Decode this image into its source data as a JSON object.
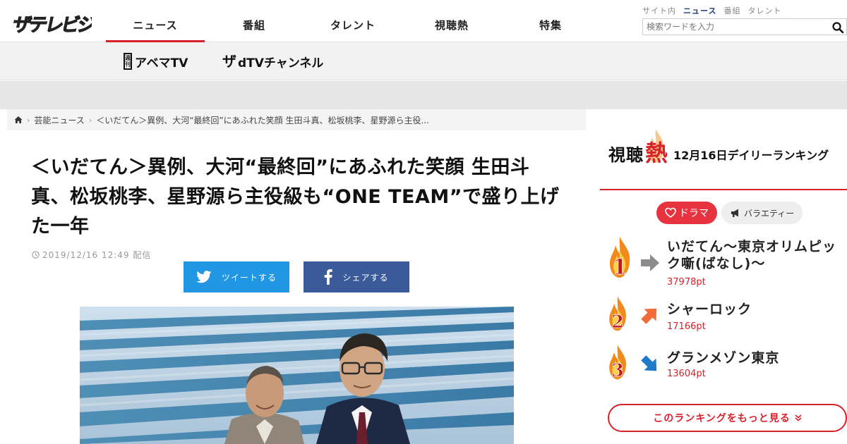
{
  "header": {
    "logo_text": "ザテレビジョン",
    "nav": [
      "ニュース",
      "番組",
      "タレント",
      "視聴熱",
      "特集"
    ],
    "active_nav": 0,
    "search": {
      "scopes": [
        "サイト内",
        "ニュース",
        "番組",
        "タレント"
      ],
      "active_scope": 1,
      "placeholder": "検索ワードを入力",
      "value": ""
    }
  },
  "subheader": {
    "links": [
      {
        "label": "アベマTV",
        "tag": "週刊",
        "icon": "weekly-tag"
      },
      {
        "label": "dTVチャンネル",
        "tag": "ザ",
        "icon": "the-tv-logo"
      }
    ]
  },
  "breadcrumb": {
    "items": [
      "芸能ニュース",
      "＜いだてん＞異例、大河“最終回”にあふれた笑顔 生田斗真、松坂桃李、星野源ら主役..."
    ]
  },
  "article": {
    "title": "＜いだてん＞異例、大河“最終回”にあふれた笑顔 生田斗真、松坂桃李、星野源ら主役級も“ONE TEAM”で盛り上げた一年",
    "date": "2019/12/16 12:49 配信",
    "share": {
      "twitter_label": "ツイートする",
      "facebook_label": "シェアする"
    }
  },
  "ranking": {
    "label": "視聴",
    "hot_label": "熱",
    "date_title": "12月16日デイリーランキング",
    "tabs": [
      {
        "label": "ドラマ",
        "icon": "heart-icon",
        "active": true
      },
      {
        "label": "バラエティー",
        "icon": "megaphone-icon",
        "active": false
      }
    ],
    "items": [
      {
        "rank": "1",
        "title": "いだてん〜東京オリムピック噺(ばなし)〜",
        "points": "37978pt",
        "trend": "flat"
      },
      {
        "rank": "2",
        "title": "シャーロック",
        "points": "17166pt",
        "trend": "up"
      },
      {
        "rank": "3",
        "title": "グランメゾン東京",
        "points": "13604pt",
        "trend": "down"
      }
    ],
    "more_label": "このランキングをもっと見る"
  },
  "colors": {
    "accent": "#d9212c",
    "twitter": "#2196e3",
    "facebook": "#3b5a9a",
    "arrow_flat": "#8c8c8c",
    "arrow_up": "#f26b3a",
    "arrow_down": "#1f7ac9"
  }
}
